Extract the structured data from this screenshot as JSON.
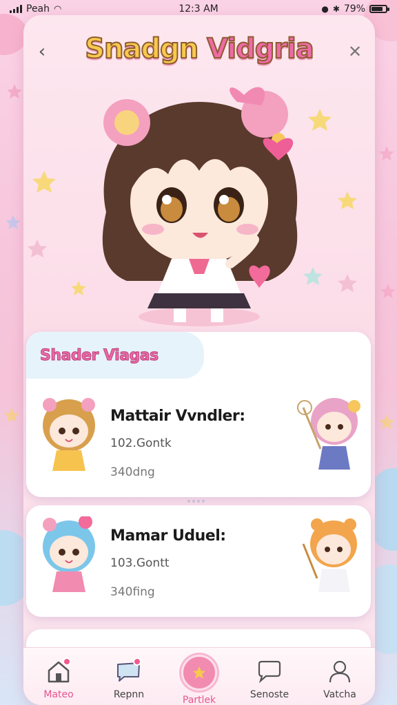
{
  "status_bar": {
    "carrier": "Peah",
    "time": "12:3 AM",
    "battery": "79%",
    "battery_level": 0.79
  },
  "header": {
    "title_part1": "Snadgn ",
    "title_part2": "Vidgria",
    "back_icon": "chevron-left-icon",
    "close_icon": "close-icon"
  },
  "hero": {
    "character": "chibi-girl-illustration"
  },
  "section": {
    "title": "Shader Viagas"
  },
  "items": [
    {
      "name": "Mattair Vvndler:",
      "sub1": "102.Gontk",
      "sub2": "340dng"
    },
    {
      "name": "Mamar Uduel:",
      "sub1": "103.Gontt",
      "sub2": "340fing"
    }
  ],
  "bottom_nav": [
    {
      "label": "Mateo",
      "icon": "home-icon",
      "badge": true
    },
    {
      "label": "Repnn",
      "icon": "message-icon",
      "badge": true
    },
    {
      "label": "Partlek",
      "icon": "star-icon",
      "badge": false,
      "active": true
    },
    {
      "label": "Senoste",
      "icon": "chat-bubble-icon",
      "badge": false
    },
    {
      "label": "Vatcha",
      "icon": "user-icon",
      "badge": false
    }
  ],
  "colors": {
    "accent_pink": "#ef6aa6",
    "title_yellow": "#f7c94e"
  }
}
